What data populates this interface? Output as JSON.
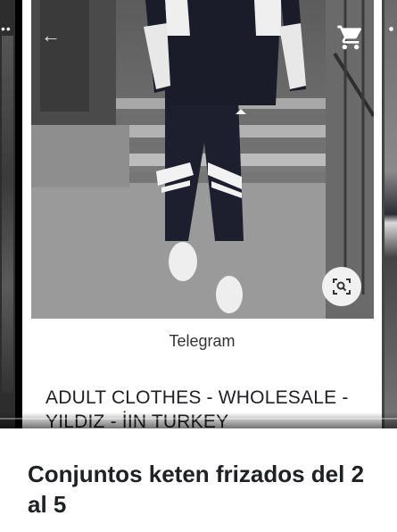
{
  "viewer": {
    "source_name": "Telegram",
    "item_title": "ADULT CLOTHES - WHOLESALE - YILDIZ - İIN TURKEY",
    "icons": {
      "back": "arrow-left-icon",
      "cart": "shopping-cart-icon",
      "lens": "lens-search-icon",
      "more": "more-dots-icon"
    }
  },
  "caption": "Conjuntos keten frizados del 2 al 5"
}
